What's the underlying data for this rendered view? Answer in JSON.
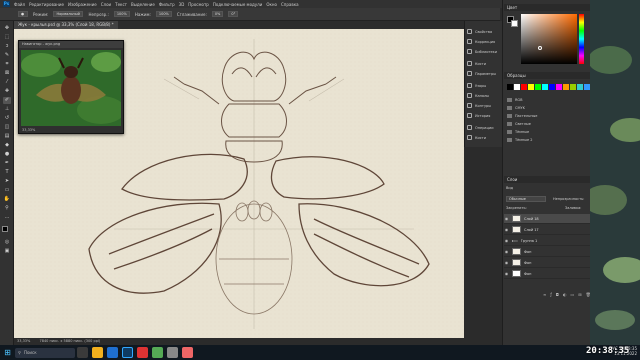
{
  "app": {
    "logo": "Ps"
  },
  "menu": [
    "Файл",
    "Редактирование",
    "Изображение",
    "Слои",
    "Текст",
    "Выделение",
    "Фильтр",
    "3D",
    "Просмотр",
    "Подключаемые модули",
    "Окно",
    "Справка"
  ],
  "options": {
    "mode_label": "Режим:",
    "mode_value": "Нормальный",
    "opacity_label": "Непрозр.:",
    "opacity_value": "100%",
    "flow_label": "Нажим:",
    "flow_value": "100%",
    "smooth_label": "Сглаживание:",
    "smooth_value": "0%",
    "angle_value": "0°"
  },
  "document": {
    "tab_label": "Жук - крылья.psd @ 33,3% (Слой 18, RGB/8) *"
  },
  "navigator": {
    "title": "Навигатор - жук.png",
    "zoom": "33,33%"
  },
  "status": {
    "zoom": "33,33%",
    "size": "7840 пикс. x 5880 пикс. (300 ppi)"
  },
  "panels": [
    {
      "icon": "properties-icon",
      "label": "Свойства"
    },
    {
      "icon": "corrections-icon",
      "label": "Коррекция"
    },
    {
      "icon": "libraries-icon",
      "label": "Библиотеки"
    },
    {
      "icon": "brushes-icon",
      "label": "Кисти"
    },
    {
      "icon": "brush-settings-icon",
      "label": "Параметры"
    },
    {
      "icon": "styles-icon",
      "label": "Узоры"
    },
    {
      "icon": "channels-icon",
      "label": "Каналы"
    },
    {
      "icon": "paths-icon",
      "label": "Контуры"
    },
    {
      "icon": "history-icon",
      "label": "История"
    },
    {
      "icon": "actions-icon",
      "label": "Операции"
    },
    {
      "icon": "gradients-icon",
      "label": "Кисти"
    },
    {
      "icon": "shapes-icon",
      "label": "Фигуры"
    }
  ],
  "color_panel": {
    "title": "Цвет"
  },
  "swatches_panel": {
    "title": "Образцы",
    "colors": [
      "#000000",
      "#ffffff",
      "#ff0000",
      "#ffff00",
      "#00ff00",
      "#00ffff",
      "#0000ff",
      "#ff00ff",
      "#ff9900",
      "#99cc00",
      "#33cccc",
      "#3399ff",
      "#cc66ff",
      "#ff6699"
    ],
    "groups": [
      "RGB",
      "CMYK",
      "Пастельные",
      "Светлые",
      "Тёмные",
      "Тёмные 2"
    ]
  },
  "layers_panel": {
    "title": "Слои",
    "filter_label": "Вид",
    "blend_value": "Обычные",
    "opacity_label": "Непрозрачность:",
    "opacity_value": "100%",
    "lock_label": "Закрепить:",
    "fill_label": "Заливка:",
    "fill_value": "100%",
    "layers": [
      {
        "name": "Слой 18"
      },
      {
        "name": "Слой 17"
      },
      {
        "name": "Группа 1"
      },
      {
        "name": "Фон"
      },
      {
        "name": "Фон"
      },
      {
        "name": "Фон"
      }
    ]
  },
  "taskbar": {
    "search": "Поиск",
    "lang": "РУС",
    "time": "20:38:35",
    "date": "13.11.2022",
    "overlay_time": "20:38:35"
  },
  "colors": {
    "accent": "#31a8ff",
    "foreground": "#000000",
    "background": "#ffffff"
  }
}
